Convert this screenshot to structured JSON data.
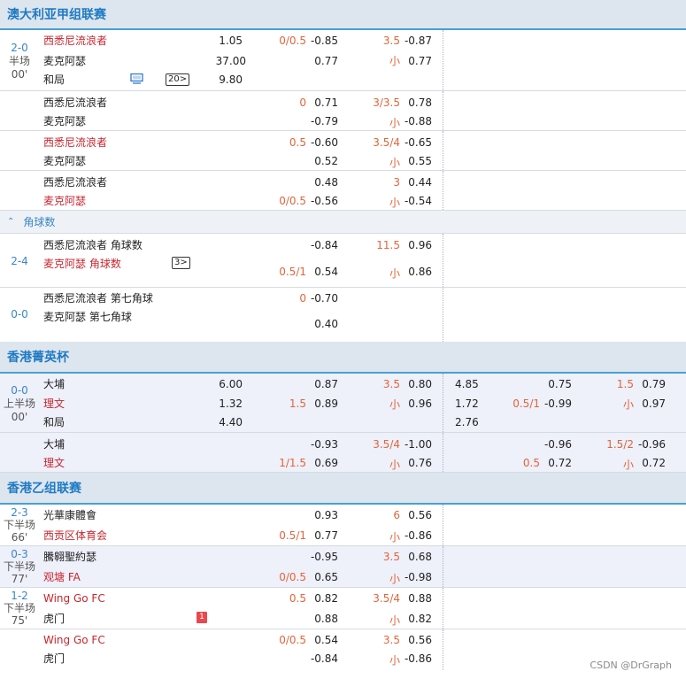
{
  "leagues": {
    "a_league": "澳大利亚甲组联赛",
    "hk_cup": "香港菁英杯",
    "hk_b": "香港乙组联赛"
  },
  "corner_header": {
    "label": "角球数"
  },
  "teams": {
    "wsw": "西悉尼流浪者",
    "mac": "麦克阿瑟",
    "draw": "和局",
    "taipo": "大埔",
    "lee": "理文",
    "kwong": "光華康體會",
    "saikung": "西贡区体育会",
    "tengyi": "騰翱聖約瑟",
    "kwuntong": "观塘 FA",
    "winggo": "Wing Go FC",
    "tiger": "虎门",
    "wsw_corner": "西悉尼流浪者 角球数",
    "mac_corner": "麦克阿瑟 角球数",
    "wsw_7th": "西悉尼流浪者 第七角球",
    "mac_7th": "麦克阿瑟 第七角球"
  },
  "m1": {
    "score": "2-0",
    "period": "半场",
    "minute": "00'",
    "more": "20",
    "o1": "1.05",
    "o2": "37.00",
    "o3": "9.80",
    "hcap": "0/0.5",
    "h1": "-0.85",
    "h2": "0.77",
    "ou": "3.5",
    "u": "小",
    "ou1": "-0.87",
    "ou2": "0.77"
  },
  "m2": {
    "hcap": "0",
    "h1": "0.71",
    "h2": "-0.79",
    "ou": "3/3.5",
    "u": "小",
    "ou1": "0.78",
    "ou2": "-0.88"
  },
  "m3": {
    "hcap": "0.5",
    "h1": "-0.60",
    "h2": "0.52",
    "ou": "3.5/4",
    "u": "小",
    "ou1": "-0.65",
    "ou2": "0.55"
  },
  "m4": {
    "hcap": "0/0.5",
    "h1": "0.48",
    "h2": "-0.56",
    "ou": "3",
    "u": "小",
    "ou1": "0.44",
    "ou2": "-0.54"
  },
  "c1": {
    "score": "2-4",
    "more": "3",
    "hcap": "0.5/1",
    "h1": "-0.84",
    "h2": "0.54",
    "ou": "11.5",
    "u": "小",
    "ou1": "0.96",
    "ou2": "0.86"
  },
  "c2": {
    "score": "0-0",
    "hcap": "0",
    "h1": "-0.70",
    "h2": "0.40"
  },
  "hk1": {
    "score": "0-0",
    "period": "上半场",
    "minute": "00'",
    "o1": "6.00",
    "o2": "1.32",
    "o3": "4.40",
    "hcap": "1.5",
    "h1": "0.87",
    "h2": "0.89",
    "ou": "3.5",
    "u": "小",
    "ou1": "0.80",
    "ou2": "0.96",
    "f1": "4.85",
    "f2": "1.72",
    "f3": "2.76",
    "fhcap": "0.5/1",
    "fh1": "0.75",
    "fh2": "-0.99",
    "fou": "1.5",
    "fu": "小",
    "fou1": "0.79",
    "fou2": "0.97"
  },
  "hk2": {
    "hcap": "1/1.5",
    "h1": "-0.93",
    "h2": "0.69",
    "ou": "3.5/4",
    "u": "小",
    "ou1": "-1.00",
    "ou2": "0.76",
    "fhcap": "0.5",
    "fh1": "-0.96",
    "fh2": "0.72",
    "fou": "1.5/2",
    "fu": "小",
    "fou1": "-0.96",
    "fou2": "0.72"
  },
  "b1": {
    "score": "2-3",
    "period": "下半场",
    "minute": "66'",
    "hcap": "0.5/1",
    "h1": "0.93",
    "h2": "0.77",
    "ou": "6",
    "u": "小",
    "ou1": "0.56",
    "ou2": "-0.86"
  },
  "b2": {
    "score": "0-3",
    "period": "下半场",
    "minute": "77'",
    "hcap": "0/0.5",
    "h1": "-0.95",
    "h2": "0.65",
    "ou": "3.5",
    "u": "小",
    "ou1": "0.68",
    "ou2": "-0.98"
  },
  "b3": {
    "score": "1-2",
    "period": "下半场",
    "minute": "75'",
    "card": "1",
    "hcap": "0.5",
    "h1": "0.82",
    "h2": "0.88",
    "ou": "3.5/4",
    "u": "小",
    "ou1": "0.88",
    "ou2": "0.82"
  },
  "b4": {
    "hcap": "0/0.5",
    "h1": "0.54",
    "h2": "-0.84",
    "ou": "3.5",
    "u": "小",
    "ou1": "0.56",
    "ou2": "-0.86"
  },
  "watermark": "CSDN @DrGraph",
  "colors": {
    "header_bg": "#dde6ef",
    "accent_blue": "#1f7ac2",
    "home_red": "#c7262d",
    "odds_orange": "#e1653a",
    "live_row_bg": "#eef0fa"
  }
}
